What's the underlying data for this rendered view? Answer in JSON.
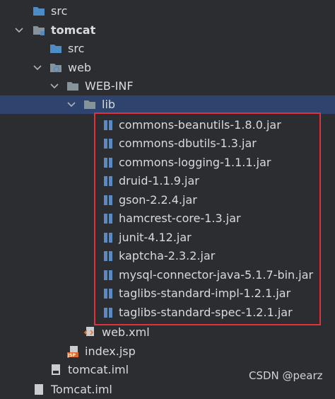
{
  "tree": {
    "src_top": "src",
    "tomcat": "tomcat",
    "tomcat_src": "src",
    "web": "web",
    "web_inf": "WEB-INF",
    "lib": "lib",
    "jars": [
      "commons-beanutils-1.8.0.jar",
      "commons-dbutils-1.3.jar",
      "commons-logging-1.1.1.jar",
      "druid-1.1.9.jar",
      "gson-2.2.4.jar",
      "hamcrest-core-1.3.jar",
      "junit-4.12.jar",
      "kaptcha-2.3.2.jar",
      "mysql-connector-java-5.1.7-bin.jar",
      "taglibs-standard-impl-1.2.1.jar",
      "taglibs-standard-spec-1.2.1.jar"
    ],
    "web_xml": "web.xml",
    "index_jsp": "index.jsp",
    "jsp_badge": "JSP",
    "tomcat_iml": "tomcat.iml",
    "bottom_partial": "Tomcat.iml"
  },
  "watermark": "CSDN @pearz",
  "colors": {
    "background": "#2b2d30",
    "selection": "#2e436e",
    "highlight_border": "#e0313c",
    "folder": "#87939a",
    "source_folder": "#4e8cc6",
    "jar": "#5b89c2"
  }
}
